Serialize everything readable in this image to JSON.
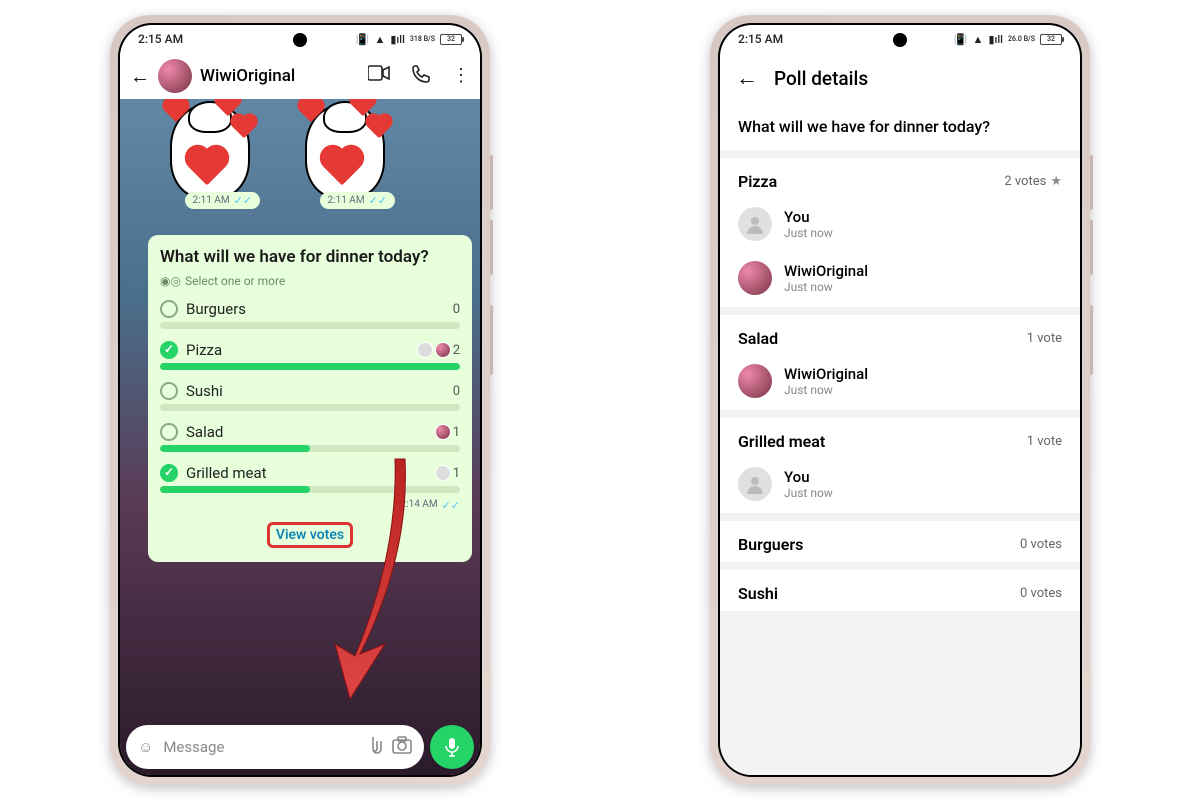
{
  "status": {
    "time": "2:15 AM",
    "net_speed": "318 B/S",
    "net_speed2": "26.0 B/S",
    "batt": "32"
  },
  "left": {
    "contact": "WiwiOriginal",
    "sticker_time": "2:11 AM",
    "poll": {
      "question": "What will we have for dinner today?",
      "hint": "Select one or more",
      "options": [
        {
          "label": "Burguers",
          "count": 0,
          "checked": false,
          "pct": 0,
          "voters": []
        },
        {
          "label": "Pizza",
          "count": 2,
          "checked": true,
          "pct": 100,
          "voters": [
            "blank",
            "p"
          ]
        },
        {
          "label": "Sushi",
          "count": 0,
          "checked": false,
          "pct": 0,
          "voters": []
        },
        {
          "label": "Salad",
          "count": 1,
          "checked": false,
          "pct": 50,
          "voters": [
            "p"
          ]
        },
        {
          "label": "Grilled meat",
          "count": 1,
          "checked": true,
          "pct": 50,
          "voters": [
            "blank"
          ]
        }
      ],
      "time": "2:14 AM",
      "view_votes": "View votes"
    },
    "input_placeholder": "Message"
  },
  "right": {
    "title": "Poll details",
    "question": "What will we have for dinner today?",
    "sections": [
      {
        "name": "Pizza",
        "votes_label": "2 votes",
        "star": true,
        "voters": [
          {
            "name": "You",
            "time": "Just now",
            "av": "blank"
          },
          {
            "name": "WiwiOriginal",
            "time": "Just now",
            "av": "p"
          }
        ]
      },
      {
        "name": "Salad",
        "votes_label": "1 vote",
        "star": false,
        "voters": [
          {
            "name": "WiwiOriginal",
            "time": "Just now",
            "av": "p"
          }
        ]
      },
      {
        "name": "Grilled meat",
        "votes_label": "1 vote",
        "star": false,
        "voters": [
          {
            "name": "You",
            "time": "Just now",
            "av": "blank"
          }
        ]
      },
      {
        "name": "Burguers",
        "votes_label": "0 votes",
        "star": false,
        "voters": []
      },
      {
        "name": "Sushi",
        "votes_label": "0 votes",
        "star": false,
        "voters": []
      }
    ]
  }
}
